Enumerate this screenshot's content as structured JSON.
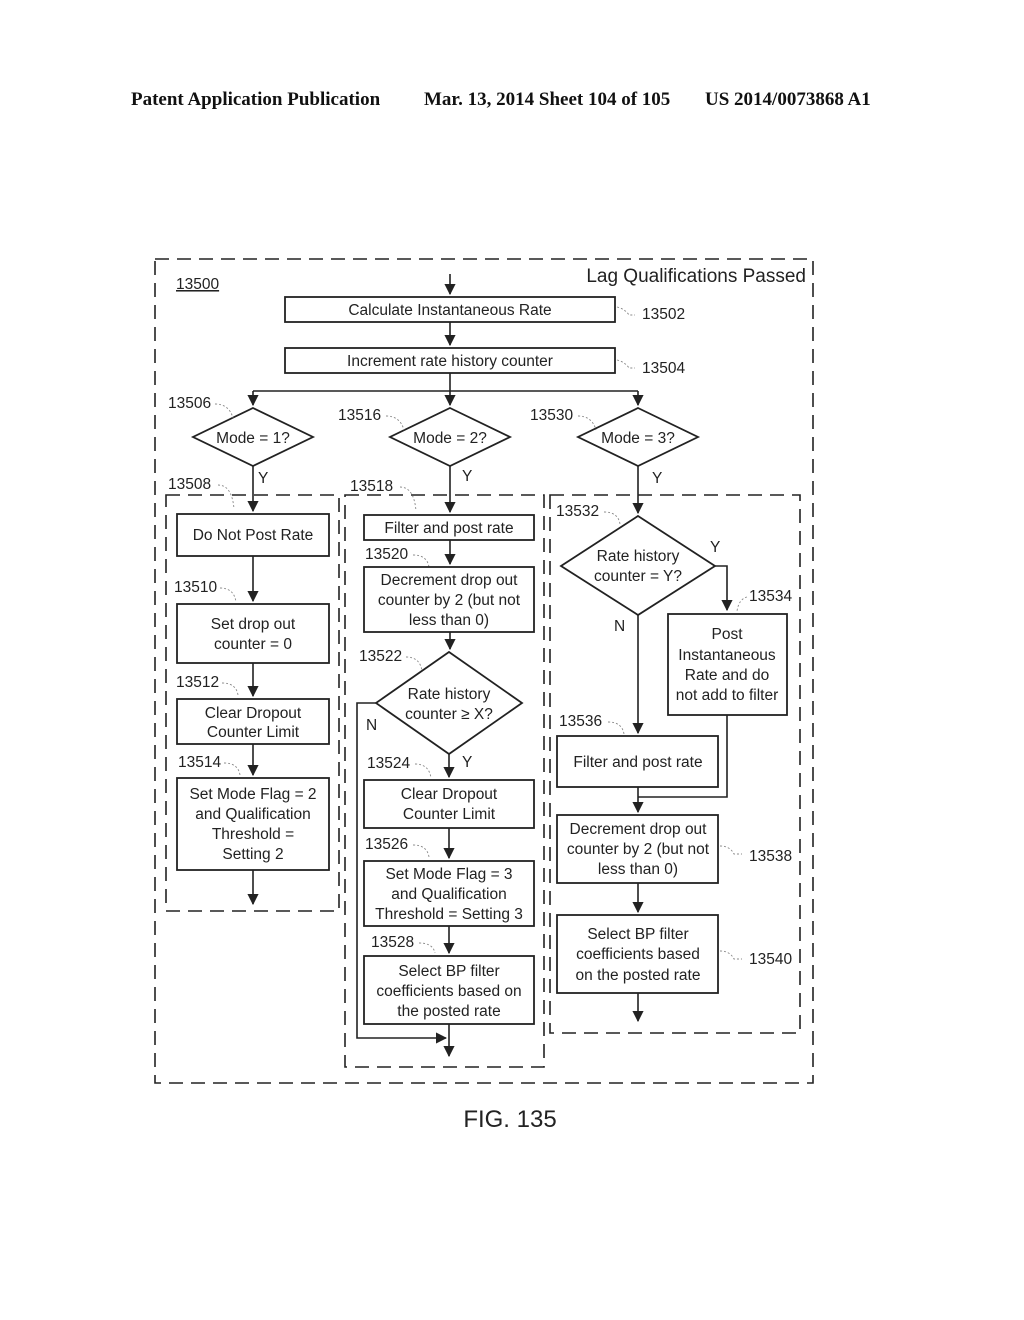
{
  "header": {
    "publication": "Patent Application Publication",
    "date_sheet": "Mar. 13, 2014  Sheet 104 of 105",
    "patent_number": "US 2014/0073868 A1"
  },
  "figure": {
    "label": "FIG. 135",
    "ref_number": "13500",
    "container_title": "Lag Qualifications Passed",
    "top_steps": [
      {
        "id": "13502",
        "lines": [
          "Calculate Instantaneous Rate"
        ]
      },
      {
        "id": "13504",
        "lines": [
          "Increment rate history counter"
        ]
      }
    ],
    "decisions": [
      {
        "id": "13506",
        "lines": [
          "Mode = 1?"
        ],
        "yes": "Y"
      },
      {
        "id": "13516",
        "lines": [
          "Mode = 2?"
        ],
        "yes": "Y"
      },
      {
        "id": "13530",
        "lines": [
          "Mode = 3?"
        ],
        "yes": "Y"
      }
    ],
    "branch1": {
      "group_id": "13508",
      "steps": [
        {
          "id": "13508",
          "lines": [
            "Do Not Post Rate"
          ]
        },
        {
          "id": "13510",
          "lines": [
            "Set drop out",
            "counter = 0"
          ]
        },
        {
          "id": "13512",
          "lines": [
            "Clear Dropout",
            "Counter Limit"
          ]
        },
        {
          "id": "13514",
          "lines": [
            "Set Mode Flag = 2",
            "and  Qualification",
            "Threshold =",
            "Setting 2"
          ]
        }
      ]
    },
    "branch2": {
      "group_id": "13518",
      "steps": [
        {
          "id": "13518",
          "lines": [
            "Filter and post rate"
          ]
        },
        {
          "id": "13520",
          "lines": [
            "Decrement  drop out",
            "counter by 2 (but not",
            "less than 0)"
          ]
        },
        {
          "id": "13524",
          "lines": [
            "Clear Dropout",
            "Counter Limit"
          ]
        },
        {
          "id": "13526",
          "lines": [
            "Set Mode Flag = 3",
            "and Qualification",
            "Threshold = Setting 3"
          ]
        },
        {
          "id": "13528",
          "lines": [
            "Select BP filter",
            "coefficients based on",
            "the posted rate"
          ]
        }
      ],
      "decision": {
        "id": "13522",
        "lines": [
          "Rate history",
          "counter ≥ X?"
        ],
        "yes": "Y",
        "no": "N"
      }
    },
    "branch3": {
      "group_id": "13532",
      "decision": {
        "id": "13532",
        "lines": [
          "Rate history",
          "counter = Y?"
        ],
        "yes": "Y",
        "no": "N"
      },
      "steps": [
        {
          "id": "13534",
          "lines": [
            "Post",
            "Instantaneous",
            "Rate and do",
            "not add to filter"
          ]
        },
        {
          "id": "13536",
          "lines": [
            "Filter and post rate"
          ]
        },
        {
          "id": "13538",
          "lines": [
            "Decrement drop out",
            "counter by 2 (but not",
            "less than 0)"
          ]
        },
        {
          "id": "13540",
          "lines": [
            "Select BP filter",
            "coefficients based",
            "on the posted rate"
          ]
        }
      ]
    }
  }
}
